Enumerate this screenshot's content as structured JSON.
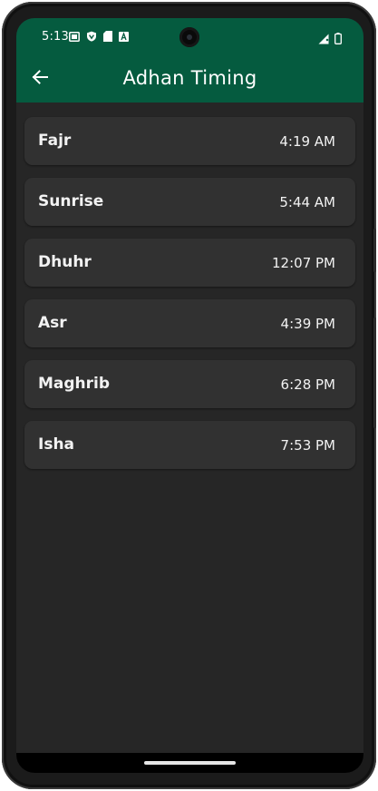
{
  "status_bar": {
    "time": "5:13",
    "left_icons": [
      "screenshot-icon",
      "vpn-shield-icon",
      "sd-card-icon",
      "font-a-icon"
    ],
    "right_icons": [
      "signal-icon",
      "battery-icon"
    ]
  },
  "app_bar": {
    "title": "Adhan Timing",
    "back_icon": "arrow-left-icon"
  },
  "prayers": [
    {
      "name": "Fajr",
      "time": "4:19 AM"
    },
    {
      "name": "Sunrise",
      "time": "5:44 AM"
    },
    {
      "name": "Dhuhr",
      "time": "12:07 PM"
    },
    {
      "name": "Asr",
      "time": "4:39 PM"
    },
    {
      "name": "Maghrib",
      "time": "6:28 PM"
    },
    {
      "name": "Isha",
      "time": "7:53 PM"
    }
  ],
  "colors": {
    "app_bar": "#055b3f",
    "background": "#262626",
    "card": "#313131",
    "text": "#f2f2f2"
  }
}
